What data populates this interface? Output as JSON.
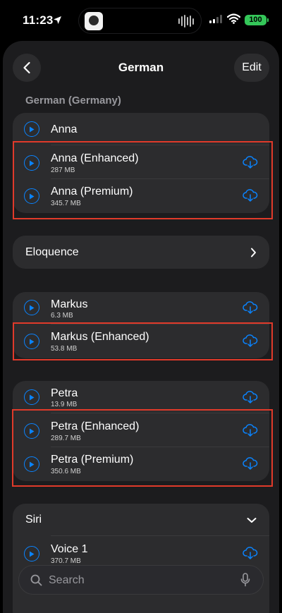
{
  "status_bar": {
    "time": "11:23",
    "battery": "100"
  },
  "nav": {
    "title": "German",
    "edit_label": "Edit"
  },
  "section_header": "German (Germany)",
  "groups": {
    "anna": [
      {
        "name": "Anna",
        "size": ""
      },
      {
        "name": "Anna (Enhanced)",
        "size": "287 MB"
      },
      {
        "name": "Anna (Premium)",
        "size": "345.7 MB"
      }
    ],
    "eloquence": {
      "label": "Eloquence"
    },
    "markus": [
      {
        "name": "Markus",
        "size": "6.3 MB"
      },
      {
        "name": "Markus (Enhanced)",
        "size": "53.8 MB"
      }
    ],
    "petra": [
      {
        "name": "Petra",
        "size": "13.9 MB"
      },
      {
        "name": "Petra (Enhanced)",
        "size": "289.7 MB"
      },
      {
        "name": "Petra (Premium)",
        "size": "350.6 MB"
      }
    ],
    "siri": {
      "label": "Siri",
      "voices": [
        {
          "name": "Voice 1",
          "size": "370.7 MB"
        }
      ]
    }
  },
  "search": {
    "placeholder": "Search"
  },
  "colors": {
    "accent": "#0a84ff",
    "highlight": "#e03a2a",
    "battery": "#34c759"
  }
}
